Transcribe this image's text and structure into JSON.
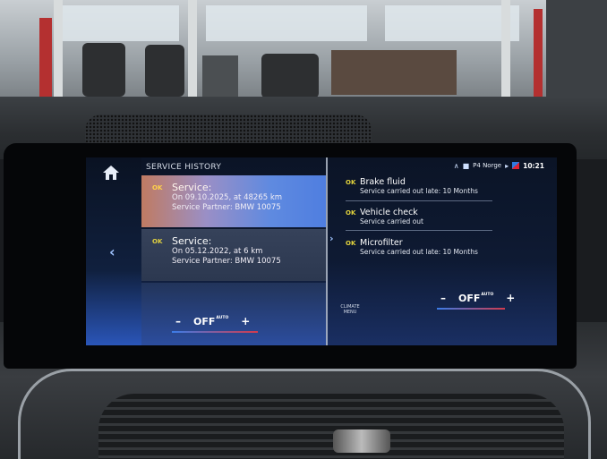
{
  "header": {
    "title": "SERVICE HISTORY"
  },
  "status_bar": {
    "station": "P4 Norge",
    "time": "10:21"
  },
  "history": [
    {
      "ok": "OK",
      "title": "Service:",
      "line1": "On 09.10.2025, at 48265 km",
      "line2": "Service Partner: BMW 10075"
    },
    {
      "ok": "OK",
      "title": "Service:",
      "line1": "On 05.12.2022, at 6 km",
      "line2": "Service Partner: BMW 10075"
    }
  ],
  "details": [
    {
      "ok": "OK",
      "title": "Brake fluid",
      "sub": "Service carried out late: 10 Months"
    },
    {
      "ok": "OK",
      "title": "Vehicle check",
      "sub": "Service carried out"
    },
    {
      "ok": "OK",
      "title": "Microfilter",
      "sub": "Service carried out late: 10 Months"
    }
  ],
  "climate": {
    "menu_label_1": "CLIMATE",
    "menu_label_2": "MENU",
    "minus": "–",
    "plus": "+",
    "left_value": "OFF",
    "right_value": "OFF",
    "auto": "AUTO"
  },
  "colors": {
    "ok_badge": "#e3d43c",
    "highlight": "#5f8ae0",
    "temp_cold": "#3a7ce8",
    "temp_hot": "#d23b4d"
  },
  "icons": {
    "home": "home-icon",
    "back": "chevron-left-icon",
    "next": "chevron-right-icon"
  }
}
